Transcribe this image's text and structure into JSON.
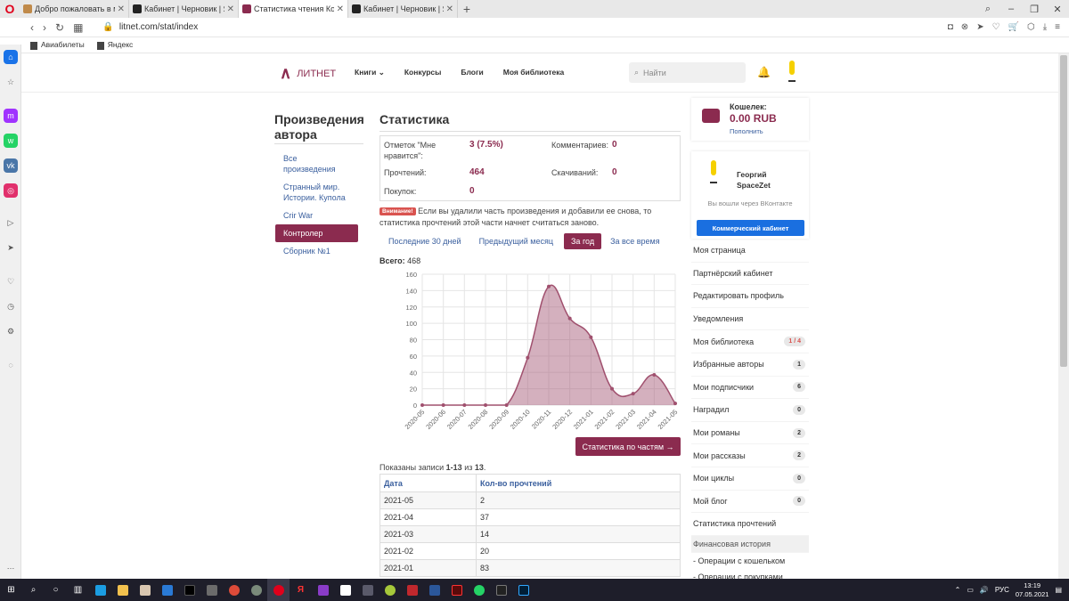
{
  "browser": {
    "tabs": [
      {
        "title": "Добро пожаловать в ма:",
        "favicon_color": "#c08a4a",
        "active": false
      },
      {
        "title": "Кабинет | Черновик | Янд",
        "favicon_color": "#222222",
        "active": false
      },
      {
        "title": "Статистика чтения Контр",
        "favicon_color": "#8b2b4f",
        "active": true
      },
      {
        "title": "Кабинет | Черновик | Янд",
        "favicon_color": "#222222",
        "active": false
      }
    ],
    "url": "litnet.com/stat/index",
    "bookmarks": [
      "Авиабилеты",
      "Яндекс"
    ]
  },
  "site": {
    "logo": "ЛИТНЕТ",
    "menu": [
      "Книги",
      "Конкурсы",
      "Блоги",
      "Моя библиотека"
    ],
    "search_placeholder": "Найти"
  },
  "left": {
    "title": "Произведения автора",
    "items": [
      {
        "label": "Все произведения",
        "active": false
      },
      {
        "label": "Странный мир. Истории. Купола",
        "active": false
      },
      {
        "label": "Crir War",
        "active": false
      },
      {
        "label": "Контролер",
        "active": true
      },
      {
        "label": "Сборник №1",
        "active": false
      }
    ]
  },
  "stats": {
    "title": "Статистика",
    "likes_label": "Отметок \"Мне нравится\":",
    "likes_value": "3 (7.5%)",
    "comments_label": "Комментариев:",
    "comments_value": "0",
    "reads_label": "Прочтений:",
    "reads_value": "464",
    "downloads_label": "Скачиваний:",
    "downloads_value": "0",
    "purchases_label": "Покупок:",
    "purchases_value": "0"
  },
  "warning": {
    "badge": "Внимание!",
    "text": "Если вы удалили часть произведения и добавили ее снова, то статистика прочтений этой части начнет считаться заново."
  },
  "periods": [
    {
      "label": "Последние 30 дней",
      "active": false
    },
    {
      "label": "Предыдущий месяц",
      "active": false
    },
    {
      "label": "За год",
      "active": true
    },
    {
      "label": "За все время",
      "active": false
    }
  ],
  "total_label": "Всего:",
  "total_value": "468",
  "chart_data": {
    "type": "area",
    "x": [
      "2020-05",
      "2020-06",
      "2020-07",
      "2020-08",
      "2020-09",
      "2020-10",
      "2020-11",
      "2020-12",
      "2021-01",
      "2021-02",
      "2021-03",
      "2021-04",
      "2021-05"
    ],
    "series": [
      {
        "values": [
          0,
          0,
          0,
          0,
          0,
          58,
          145,
          106,
          83,
          20,
          14,
          37,
          2
        ]
      }
    ],
    "ylim": [
      0,
      160
    ],
    "yticks": [
      0,
      20,
      40,
      60,
      80,
      100,
      120,
      140,
      160
    ],
    "grid": true,
    "color": "#a0506e"
  },
  "parts_button": "Статистика по частям →",
  "records": {
    "prefix": "Показаны записи",
    "range": "1-13",
    "of": "из",
    "total": "13",
    "suffix": "."
  },
  "table": {
    "headers": [
      "Дата",
      "Кол-во прочтений"
    ],
    "rows": [
      [
        "2021-05",
        "2"
      ],
      [
        "2021-04",
        "37"
      ],
      [
        "2021-03",
        "14"
      ],
      [
        "2021-02",
        "20"
      ],
      [
        "2021-01",
        "83"
      ]
    ]
  },
  "wallet": {
    "label": "Кошелек:",
    "value": "0.00 RUB",
    "refill": "Пополнить"
  },
  "profile": {
    "name": "Георгий SpaceZet",
    "vk": "Вы вошли через ВКонтакте",
    "commercial": "Коммерческий кабинет"
  },
  "right_menu": [
    {
      "label": "Моя страница",
      "count": ""
    },
    {
      "label": "Партнёрский кабинет",
      "count": ""
    },
    {
      "label": "Редактировать профиль",
      "count": ""
    },
    {
      "label": "Уведомления",
      "count": ""
    },
    {
      "label": "Моя библиотека",
      "count": "1 / 4"
    },
    {
      "label": "Избранные авторы",
      "count": "1"
    },
    {
      "label": "Мои подписчики",
      "count": "6"
    },
    {
      "label": "Наградил",
      "count": "0"
    },
    {
      "label": "Мои романы",
      "count": "2"
    },
    {
      "label": "Мои рассказы",
      "count": "2"
    },
    {
      "label": "Мои циклы",
      "count": "0"
    },
    {
      "label": "Мой блог",
      "count": "0"
    },
    {
      "label": "Статистика прочтений",
      "count": ""
    }
  ],
  "finance": {
    "title": "Финансовая история",
    "items": [
      "- Операции с кошельком",
      "- Операции с покупками"
    ]
  },
  "taskbar": {
    "lang": "РУС",
    "time": "13:19",
    "date": "07.05.2021"
  }
}
